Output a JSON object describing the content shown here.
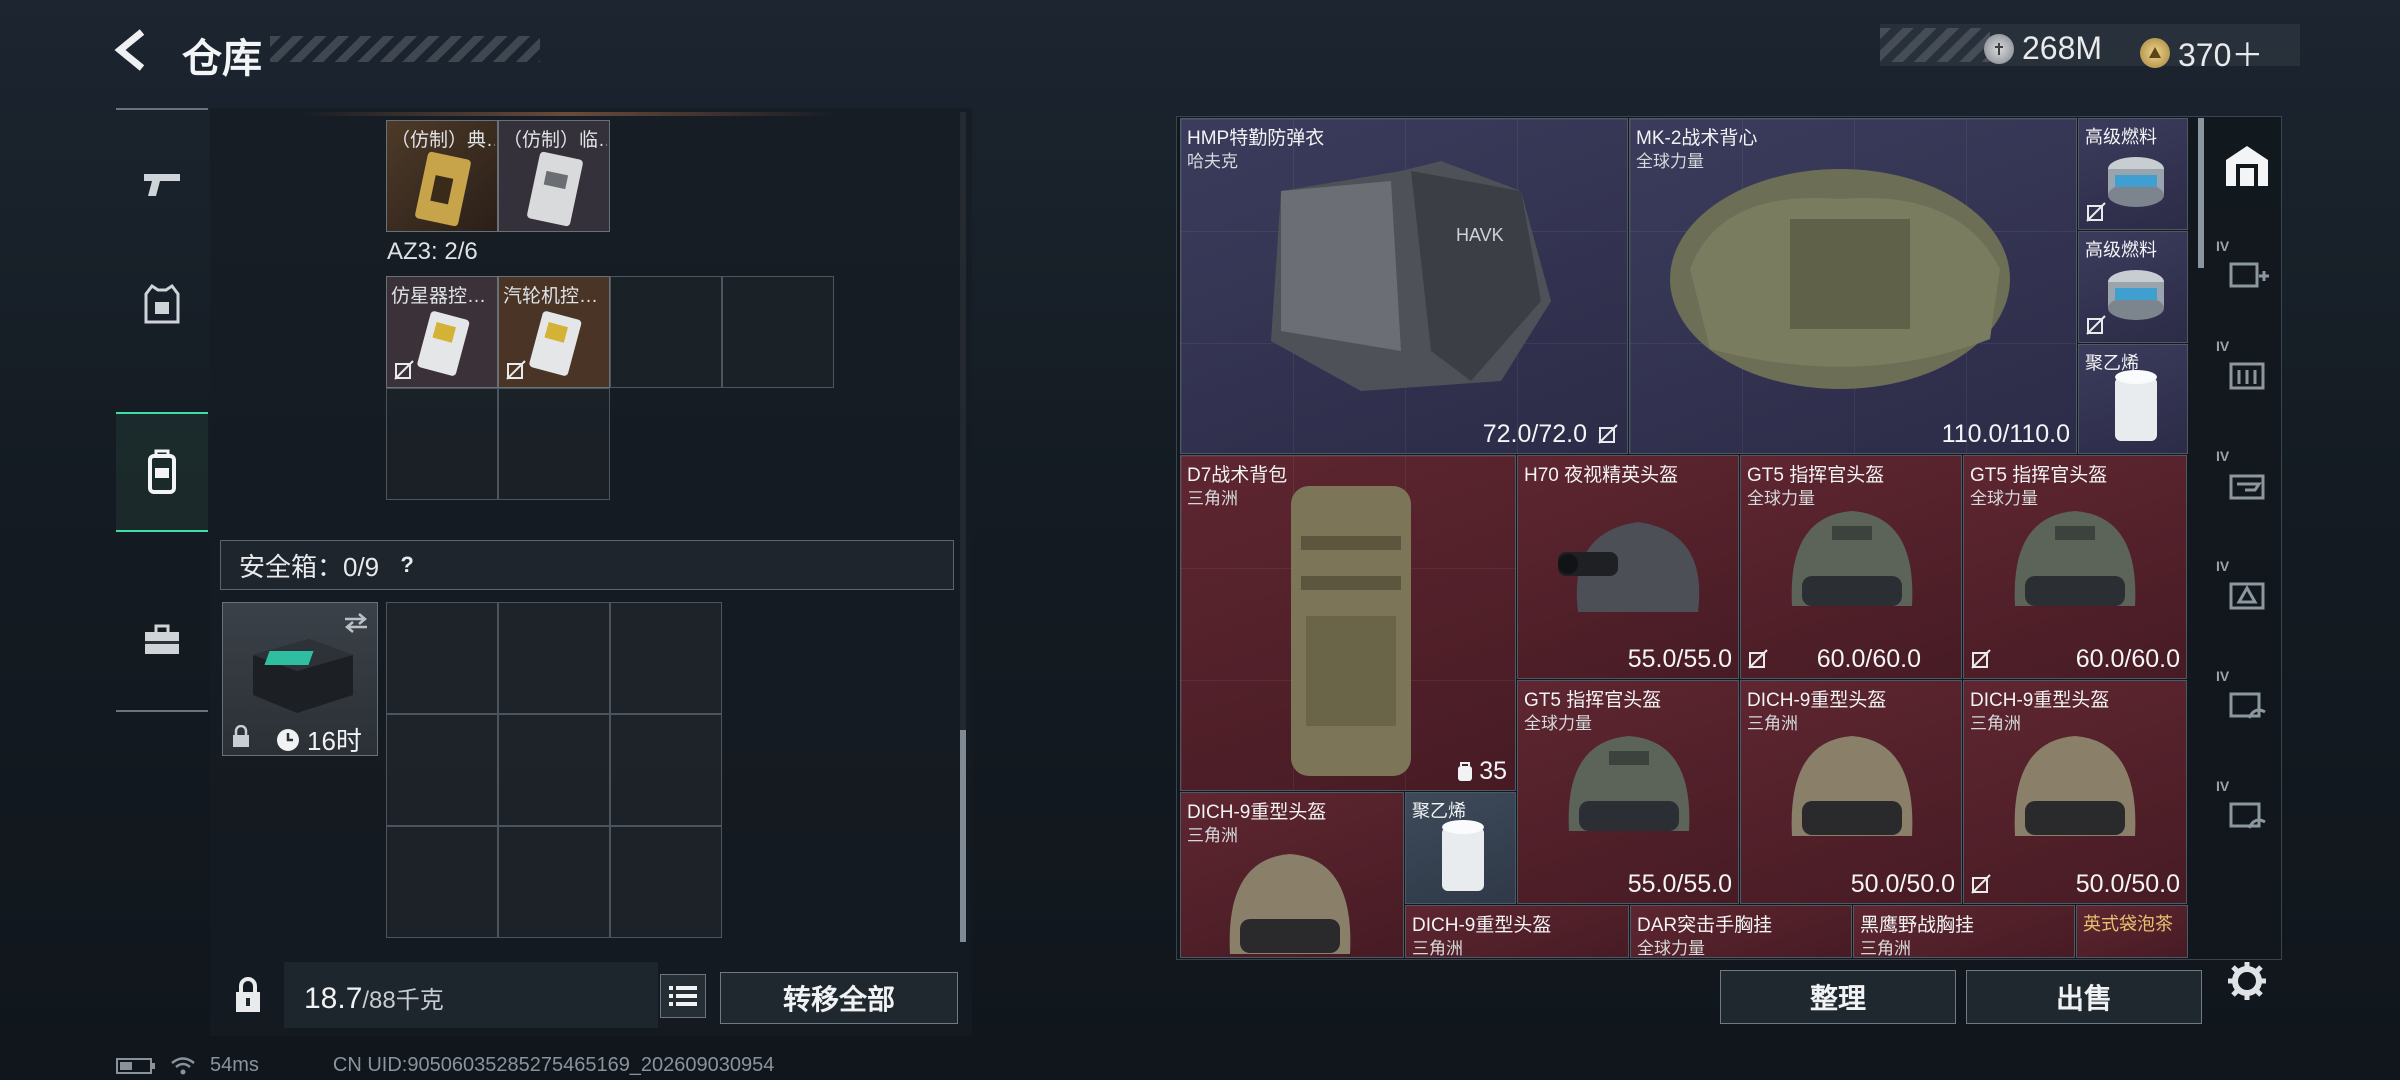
{
  "header": {
    "title": "仓库",
    "back_icon": "chevron-left-icon",
    "currencies": [
      {
        "icon": "silver-coin-icon",
        "value": "268M"
      },
      {
        "icon": "gold-triangle-coin-icon",
        "value": "370＋"
      }
    ]
  },
  "left_tabs": [
    {
      "icon": "pistol-icon",
      "active": false
    },
    {
      "icon": "tactical-vest-icon",
      "active": false
    },
    {
      "icon": "backpack-icon",
      "active": true
    },
    {
      "icon": "briefcase-icon",
      "active": false
    }
  ],
  "left_panel": {
    "top_items": [
      {
        "label": "（仿制）典…",
        "no_drop": false
      },
      {
        "label": "（仿制）临…",
        "no_drop": false
      }
    ],
    "az3_label": "AZ3: 2/6",
    "az3_items": [
      {
        "label": "仿星器控…",
        "no_drop": true
      },
      {
        "label": "汽轮机控…",
        "no_drop": true
      }
    ],
    "safebox": {
      "label": "安全箱：0/9",
      "help": "?",
      "item_timer": "16时"
    },
    "weight": {
      "current": "18.7",
      "max": "/88千克"
    },
    "transfer_label": "转移全部"
  },
  "status_bar": {
    "ping": "54ms",
    "uid": "CN UID:9050603528527546516​9_202609030954"
  },
  "right_panel": {
    "items": [
      {
        "name": "HMP特勤防弹衣",
        "sub": "哈夫克",
        "durability": "72.0/72.0",
        "bg": "purple"
      },
      {
        "name": "MK-2战术背心",
        "sub": "全球力量",
        "durability": "110.0/110.0",
        "bg": "purple"
      },
      {
        "name": "高级燃料",
        "sub": "",
        "durability": "",
        "bg": "purple"
      },
      {
        "name": "高级燃料",
        "sub": "",
        "durability": "",
        "bg": "purple"
      },
      {
        "name": "聚乙烯",
        "sub": "",
        "durability": "",
        "bg": "purple"
      },
      {
        "name": "D7战术背包",
        "sub": "三角洲",
        "durability": "35",
        "bg": "red"
      },
      {
        "name": "H70 夜视精英头盔",
        "sub": "",
        "durability": "55.0/55.0",
        "bg": "red"
      },
      {
        "name": "GT5 指挥官头盔",
        "sub": "全球力量",
        "durability": "60.0/60.0",
        "bg": "red"
      },
      {
        "name": "GT5 指挥官头盔",
        "sub": "全球力量",
        "durability": "60.0/60.0",
        "bg": "red"
      },
      {
        "name": "GT5 指挥官头盔",
        "sub": "全球力量",
        "durability": "55.0/55.0",
        "bg": "red"
      },
      {
        "name": "DICH-9重型头盔",
        "sub": "三角洲",
        "durability": "50.0/50.0",
        "bg": "red"
      },
      {
        "name": "DICH-9重型头盔",
        "sub": "三角洲",
        "durability": "50.0/50.0",
        "bg": "red"
      },
      {
        "name": "DICH-9重型头盔",
        "sub": "三角洲",
        "durability": "",
        "bg": "red"
      },
      {
        "name": "聚乙烯",
        "sub": "",
        "durability": "",
        "bg": "bluegrey"
      },
      {
        "name": "DICH-9重型头盔",
        "sub": "三角洲",
        "durability": "",
        "bg": "red"
      },
      {
        "name": "DAR突击手胸挂",
        "sub": "全球力量",
        "durability": "",
        "bg": "red"
      },
      {
        "name": "黑鹰野战胸挂",
        "sub": "三角洲",
        "durability": "",
        "bg": "red"
      },
      {
        "name": "英式袋泡茶",
        "sub": "",
        "durability": "",
        "bg": "red"
      }
    ],
    "sort_label": "整理",
    "sell_label": "出售"
  },
  "right_tabs": [
    {
      "icon": "vault-icon",
      "level": ""
    },
    {
      "icon": "add-storage-icon",
      "level": "IV"
    },
    {
      "icon": "storage-shelf-icon",
      "level": "IV"
    },
    {
      "icon": "weapon-bench-icon",
      "level": "IV"
    },
    {
      "icon": "warning-storage-icon",
      "level": "IV"
    },
    {
      "icon": "hand-storage-icon",
      "level": "IV"
    },
    {
      "icon": "hand-storage-icon-2",
      "level": "IV"
    }
  ],
  "settings_icon": "gear-icon",
  "colors": {
    "accent": "#3de0a0",
    "purple_cell": "#33334f",
    "red_cell": "#52212b",
    "panel": "#161c22"
  }
}
